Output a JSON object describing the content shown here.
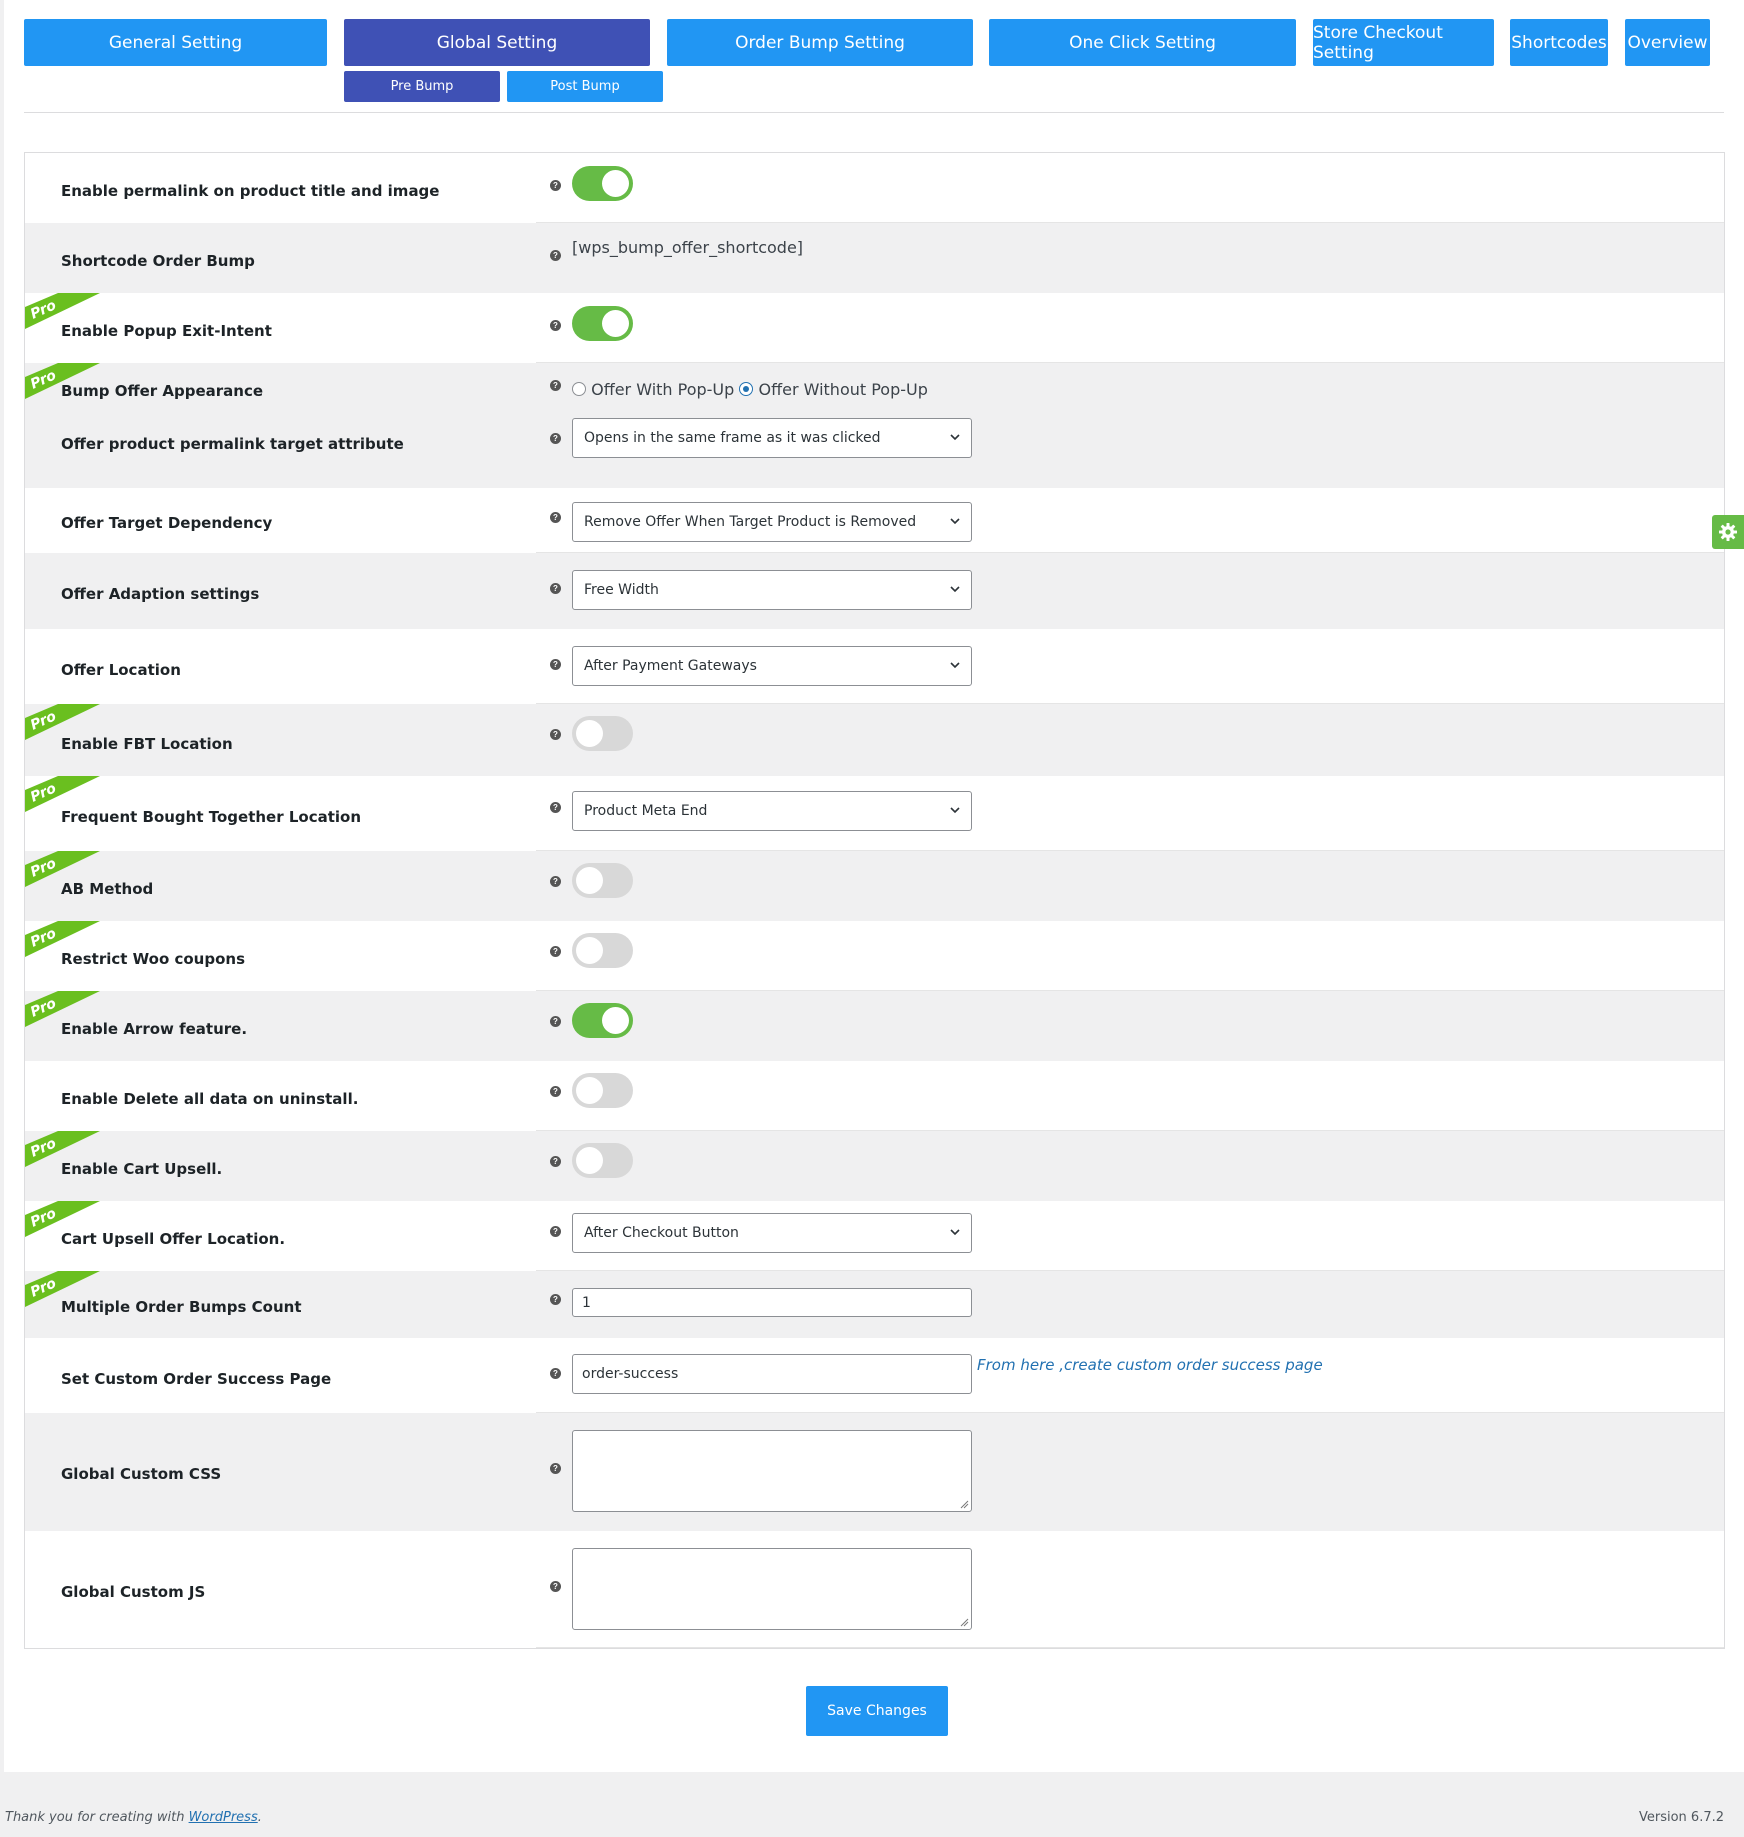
{
  "tabs": [
    {
      "label": "General Setting"
    },
    {
      "label": "Global Setting"
    },
    {
      "label": "Order Bump Setting"
    },
    {
      "label": "One Click Setting"
    },
    {
      "label": "Store Checkout Setting"
    },
    {
      "label": "Shortcodes"
    },
    {
      "label": "Overview"
    }
  ],
  "subtabs": [
    {
      "label": "Pre Bump"
    },
    {
      "label": "Post Bump"
    }
  ],
  "pro_badge": "Pro",
  "help_glyph": "?",
  "rows": {
    "permalink": {
      "label": "Enable permalink on product title and image",
      "enabled": true
    },
    "shortcode": {
      "label": "Shortcode Order Bump",
      "value": "[wps_bump_offer_shortcode]"
    },
    "popup_exit": {
      "label": "Enable Popup Exit-Intent",
      "enabled": true
    },
    "appearance": {
      "label": "Bump Offer Appearance",
      "option_a": "Offer With Pop-Up",
      "option_b": "Offer Without Pop-Up",
      "selected": "Offer Without Pop-Up"
    },
    "permalink_target": {
      "label": "Offer product permalink target attribute",
      "value": "Opens in the same frame as it was clicked"
    },
    "target_dependency": {
      "label": "Offer Target Dependency",
      "value": "Remove Offer When Target Product is Removed"
    },
    "adaption": {
      "label": "Offer Adaption settings",
      "value": "Free Width"
    },
    "location": {
      "label": "Offer Location",
      "value": "After Payment Gateways"
    },
    "fbt": {
      "label": "Enable FBT Location",
      "enabled": false
    },
    "fbt_location": {
      "label": "Frequent Bought Together Location",
      "value": "Product Meta End"
    },
    "ab": {
      "label": "AB Method",
      "enabled": false
    },
    "coupons": {
      "label": "Restrict Woo coupons",
      "enabled": false
    },
    "arrow": {
      "label": "Enable Arrow feature.",
      "enabled": true
    },
    "delete_data": {
      "label": "Enable Delete all data on uninstall.",
      "enabled": false
    },
    "cart_upsell": {
      "label": "Enable Cart Upsell.",
      "enabled": false
    },
    "cart_location": {
      "label": "Cart Upsell Offer Location.",
      "value": "After Checkout Button"
    },
    "bump_count": {
      "label": "Multiple Order Bumps Count",
      "value": "1"
    },
    "success_page": {
      "label": "Set Custom Order Success Page",
      "value": "order-success",
      "link": "From here ,create custom order success page"
    },
    "custom_css": {
      "label": "Global Custom CSS",
      "value": ""
    },
    "custom_js": {
      "label": "Global Custom JS",
      "value": ""
    }
  },
  "save_label": "Save Changes",
  "footer": {
    "thanks": "Thank you for creating with ",
    "wp_link": "WordPress",
    "period": ".",
    "version": "Version 6.7.2"
  },
  "colors": {
    "tab_blue": "#2196f3",
    "tab_active": "#3f51b5",
    "toggle_on": "#66bb46",
    "pro_green": "#6abf1f",
    "link_blue": "#2271b1"
  }
}
